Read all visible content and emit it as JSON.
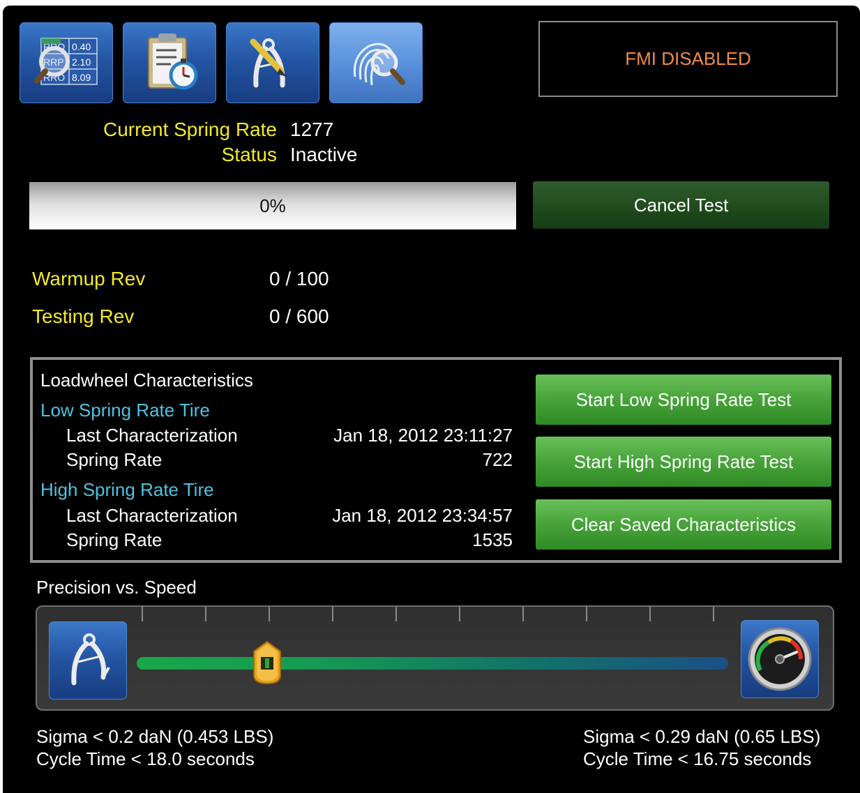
{
  "toolbar": {
    "buttons": [
      {
        "name": "results",
        "values": [
          "0.40",
          "2.10",
          "8.09"
        ],
        "row_labels": [
          "RRO",
          "RRP",
          "RRO"
        ]
      },
      {
        "name": "timed-test"
      },
      {
        "name": "calibration"
      },
      {
        "name": "fingerprint-inspect",
        "active": true
      }
    ]
  },
  "fmi_status": "FMI DISABLED",
  "spring": {
    "current_label": "Current Spring Rate",
    "current_value": "1277",
    "status_label": "Status",
    "status_value": "Inactive"
  },
  "progress": {
    "text": "0%",
    "fraction": 0.0
  },
  "cancel_label": "Cancel Test",
  "warmup": {
    "label": "Warmup Rev",
    "value": "0 / 100"
  },
  "testing": {
    "label": "Testing Rev",
    "value": "0 / 600"
  },
  "characteristics": {
    "title": "Loadwheel Characteristics",
    "low": {
      "heading": "Low Spring Rate Tire",
      "last_label": "Last Characterization",
      "last_value": "Jan 18, 2012 23:11:27",
      "rate_label": "Spring Rate",
      "rate_value": "722"
    },
    "high": {
      "heading": "High Spring Rate Tire",
      "last_label": "Last Characterization",
      "last_value": "Jan 18, 2012 23:34:57",
      "rate_label": "Spring Rate",
      "rate_value": "1535"
    },
    "buttons": {
      "low": "Start Low Spring Rate Test",
      "high": "Start High Spring Rate Test",
      "clear": "Clear Saved Characteristics"
    }
  },
  "precision": {
    "title": "Precision vs. Speed",
    "slider_fraction": 0.22,
    "tick_count": 10,
    "left_icon": "caliper-icon",
    "right_icon": "speedometer-icon",
    "left_sigma": "Sigma < 0.2 daN (0.453 LBS)",
    "left_cycle": "Cycle Time < 18.0 seconds",
    "right_sigma": "Sigma < 0.29 daN (0.65 LBS)",
    "right_cycle": "Cycle Time < 16.75 seconds"
  },
  "colors": {
    "label_yellow": "#f2ea2a",
    "fmi_orange": "#f08a4a",
    "heading_cyan": "#4ec3e2",
    "button_green": "#4aa53c",
    "cancel_green": "#1e4a1c",
    "toolbar_blue": "#2456a4"
  }
}
